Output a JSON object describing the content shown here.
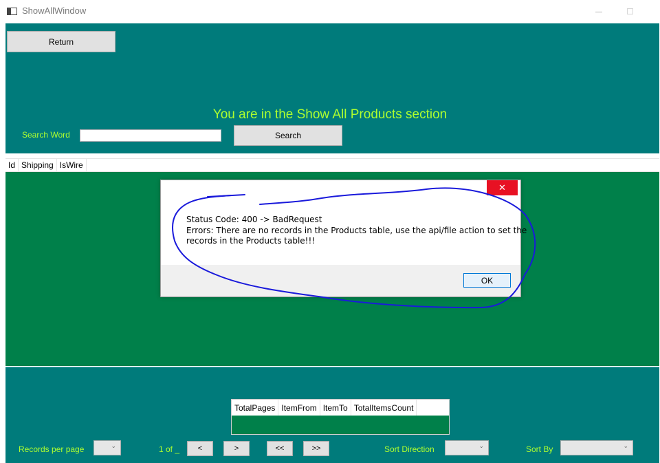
{
  "window": {
    "title": "ShowAllWindow"
  },
  "header": {
    "return_label": "Return",
    "heading": "You are in the Show All Products section",
    "search_label": "Search Word",
    "search_value": "",
    "search_button": "Search"
  },
  "grid": {
    "columns": [
      "Id",
      "Shipping",
      "IsWire"
    ],
    "rows": []
  },
  "pager": {
    "columns": [
      "TotalPages",
      "ItemFrom",
      "ItemTo",
      "TotalItemsCount"
    ],
    "records_label": "Records per page",
    "records_value": "",
    "page_label": "1 of _",
    "prev_label": "<",
    "next_label": ">",
    "first_label": "<<",
    "last_label": ">>",
    "sort_direction_label": "Sort Direction",
    "sort_direction_value": "",
    "sort_by_label": "Sort By",
    "sort_by_value": ""
  },
  "dialog": {
    "close_glyph": "✕",
    "lines": [
      "Status Code: 400 -> BadRequest",
      "Errors: There are no records in the Products table, use the api/file action to set the",
      "records in the Products table!!!"
    ],
    "ok_label": "OK"
  },
  "colors": {
    "teal": "#007b7b",
    "green": "#00804a",
    "label": "#adff2f",
    "annotation": "#1a1adb"
  }
}
